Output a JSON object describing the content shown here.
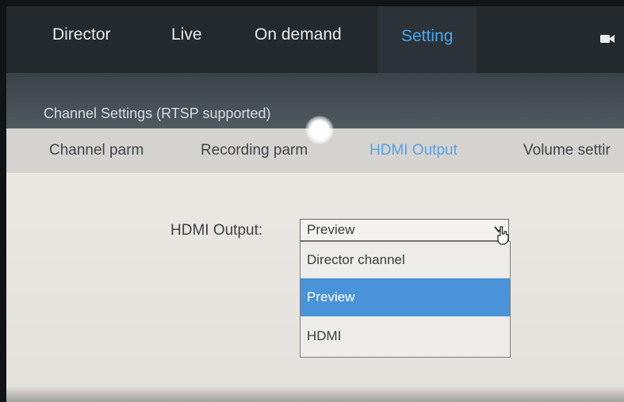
{
  "nav": {
    "items": [
      "Director",
      "Live",
      "On demand",
      "Setting"
    ],
    "active": "Setting",
    "right_icon": "camera-icon"
  },
  "channel_settings": {
    "title": "Channel Settings (RTSP supported)"
  },
  "tabs": {
    "items": [
      "Channel parm",
      "Recording parm",
      "HDMI Output",
      "Volume settir"
    ],
    "active": "HDMI Output"
  },
  "hdmi_output": {
    "label": "HDMI Output:",
    "selected": "Preview",
    "options": [
      "Director channel",
      "Preview",
      "HDMI"
    ]
  },
  "colors": {
    "accent": "#48a6ef",
    "selected_option_bg": "#4a93d8",
    "nav_bg": "#23292c"
  }
}
